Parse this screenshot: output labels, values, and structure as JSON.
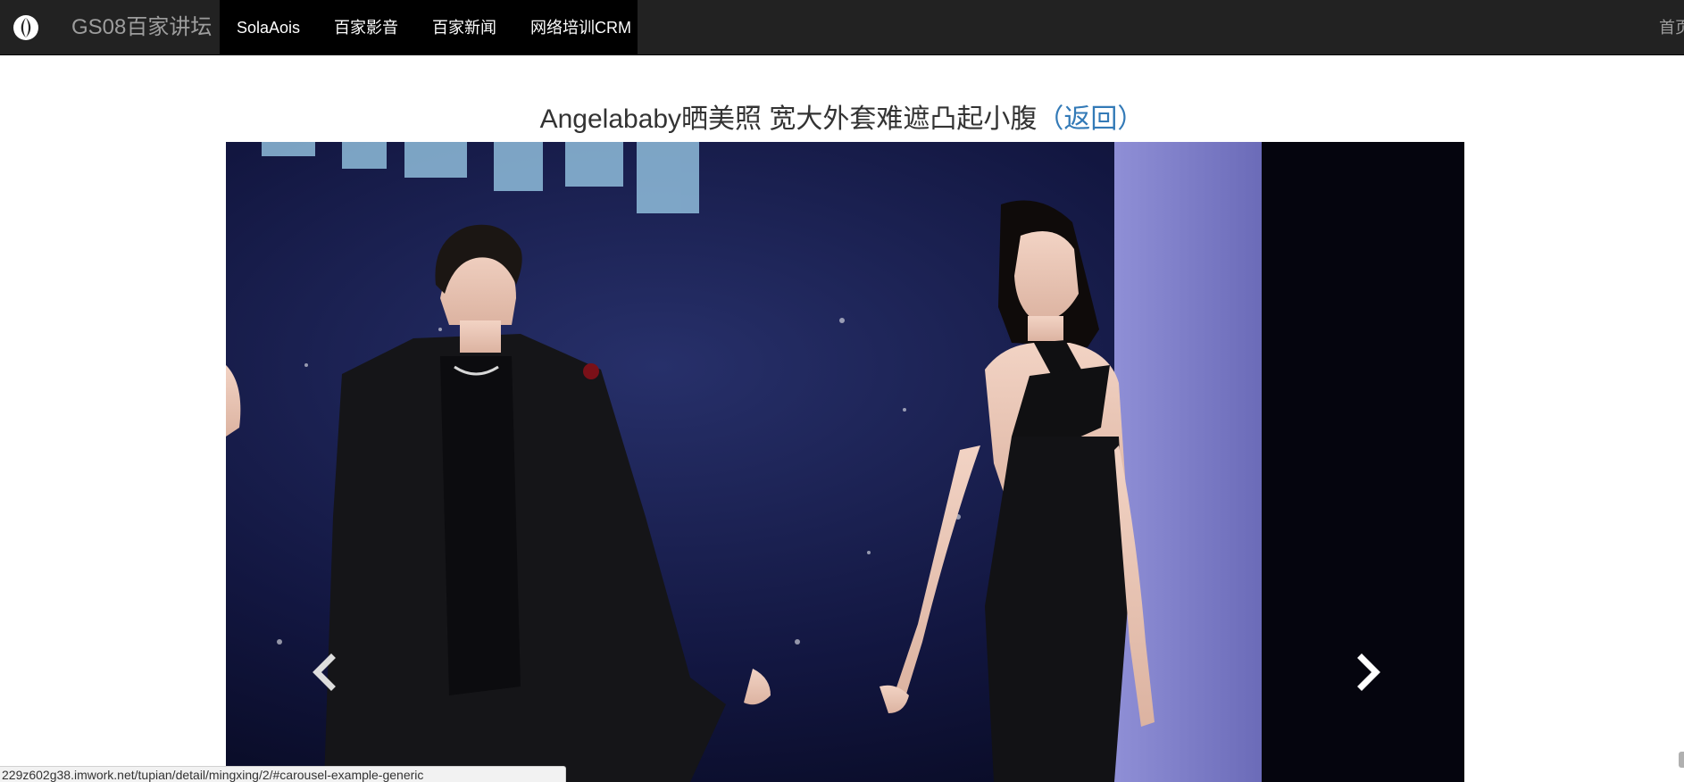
{
  "navbar": {
    "brand_title": "GS08百家讲坛",
    "items": [
      {
        "label": "SolaAois"
      },
      {
        "label": "百家影音"
      },
      {
        "label": "百家新闻"
      },
      {
        "label": "网络培训CRM"
      }
    ],
    "right_link": "首页"
  },
  "article": {
    "title": "Angelababy晒美照 宽大外套难遮凸起小腹",
    "back_label": "（返回）"
  },
  "carousel": {
    "image_alt": "photo"
  },
  "status_bar": {
    "url": "229z602g38.imwork.net/tupian/detail/mingxing/2/#carousel-example-generic"
  },
  "colors": {
    "navbar_bg": "#222222",
    "nav_active_bg": "#000000",
    "link": "#337ab7"
  }
}
